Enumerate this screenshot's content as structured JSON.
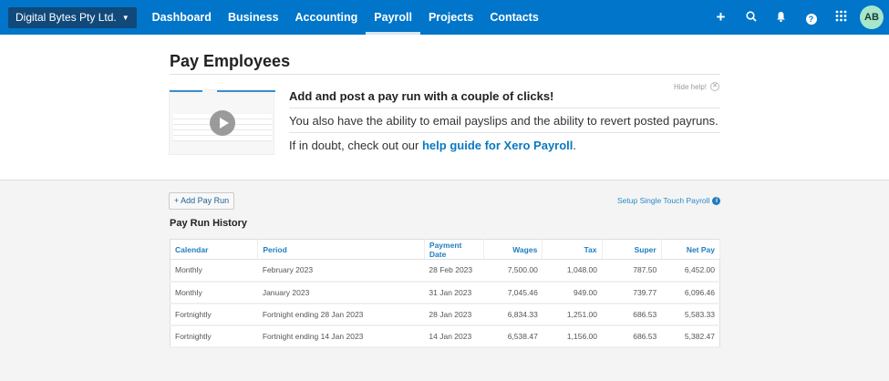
{
  "nav": {
    "org": "Digital Bytes Pty Ltd.",
    "items": [
      "Dashboard",
      "Business",
      "Accounting",
      "Payroll",
      "Projects",
      "Contacts"
    ],
    "active": "Payroll",
    "avatar": "AB"
  },
  "page": {
    "title": "Pay Employees"
  },
  "help": {
    "hide": "Hide help!",
    "heading": "Add and post a pay run with a couple of clicks!",
    "line1": "You also have the ability to email payslips and the ability to revert posted payruns.",
    "line2_prefix": "If in doubt, check out our ",
    "line2_link": "help guide for Xero Payroll",
    "line2_suffix": "."
  },
  "actions": {
    "add": "+ Add Pay Run",
    "stp": "Setup Single Touch Payroll"
  },
  "history": {
    "title": "Pay Run History",
    "columns": [
      "Calendar",
      "Period",
      "Payment Date",
      "Wages",
      "Tax",
      "Super",
      "Net Pay"
    ],
    "rows": [
      [
        "Monthly",
        "February 2023",
        "28 Feb 2023",
        "7,500.00",
        "1,048.00",
        "787.50",
        "6,452.00"
      ],
      [
        "Monthly",
        "January 2023",
        "31 Jan 2023",
        "7,045.46",
        "949.00",
        "739.77",
        "6,096.46"
      ],
      [
        "Fortnightly",
        "Fortnight ending 28 Jan 2023",
        "28 Jan 2023",
        "6,834.33",
        "1,251.00",
        "686.53",
        "5,583.33"
      ],
      [
        "Fortnightly",
        "Fortnight ending 14 Jan 2023",
        "14 Jan 2023",
        "6,538.47",
        "1,156.00",
        "686.53",
        "5,382.47"
      ]
    ]
  }
}
